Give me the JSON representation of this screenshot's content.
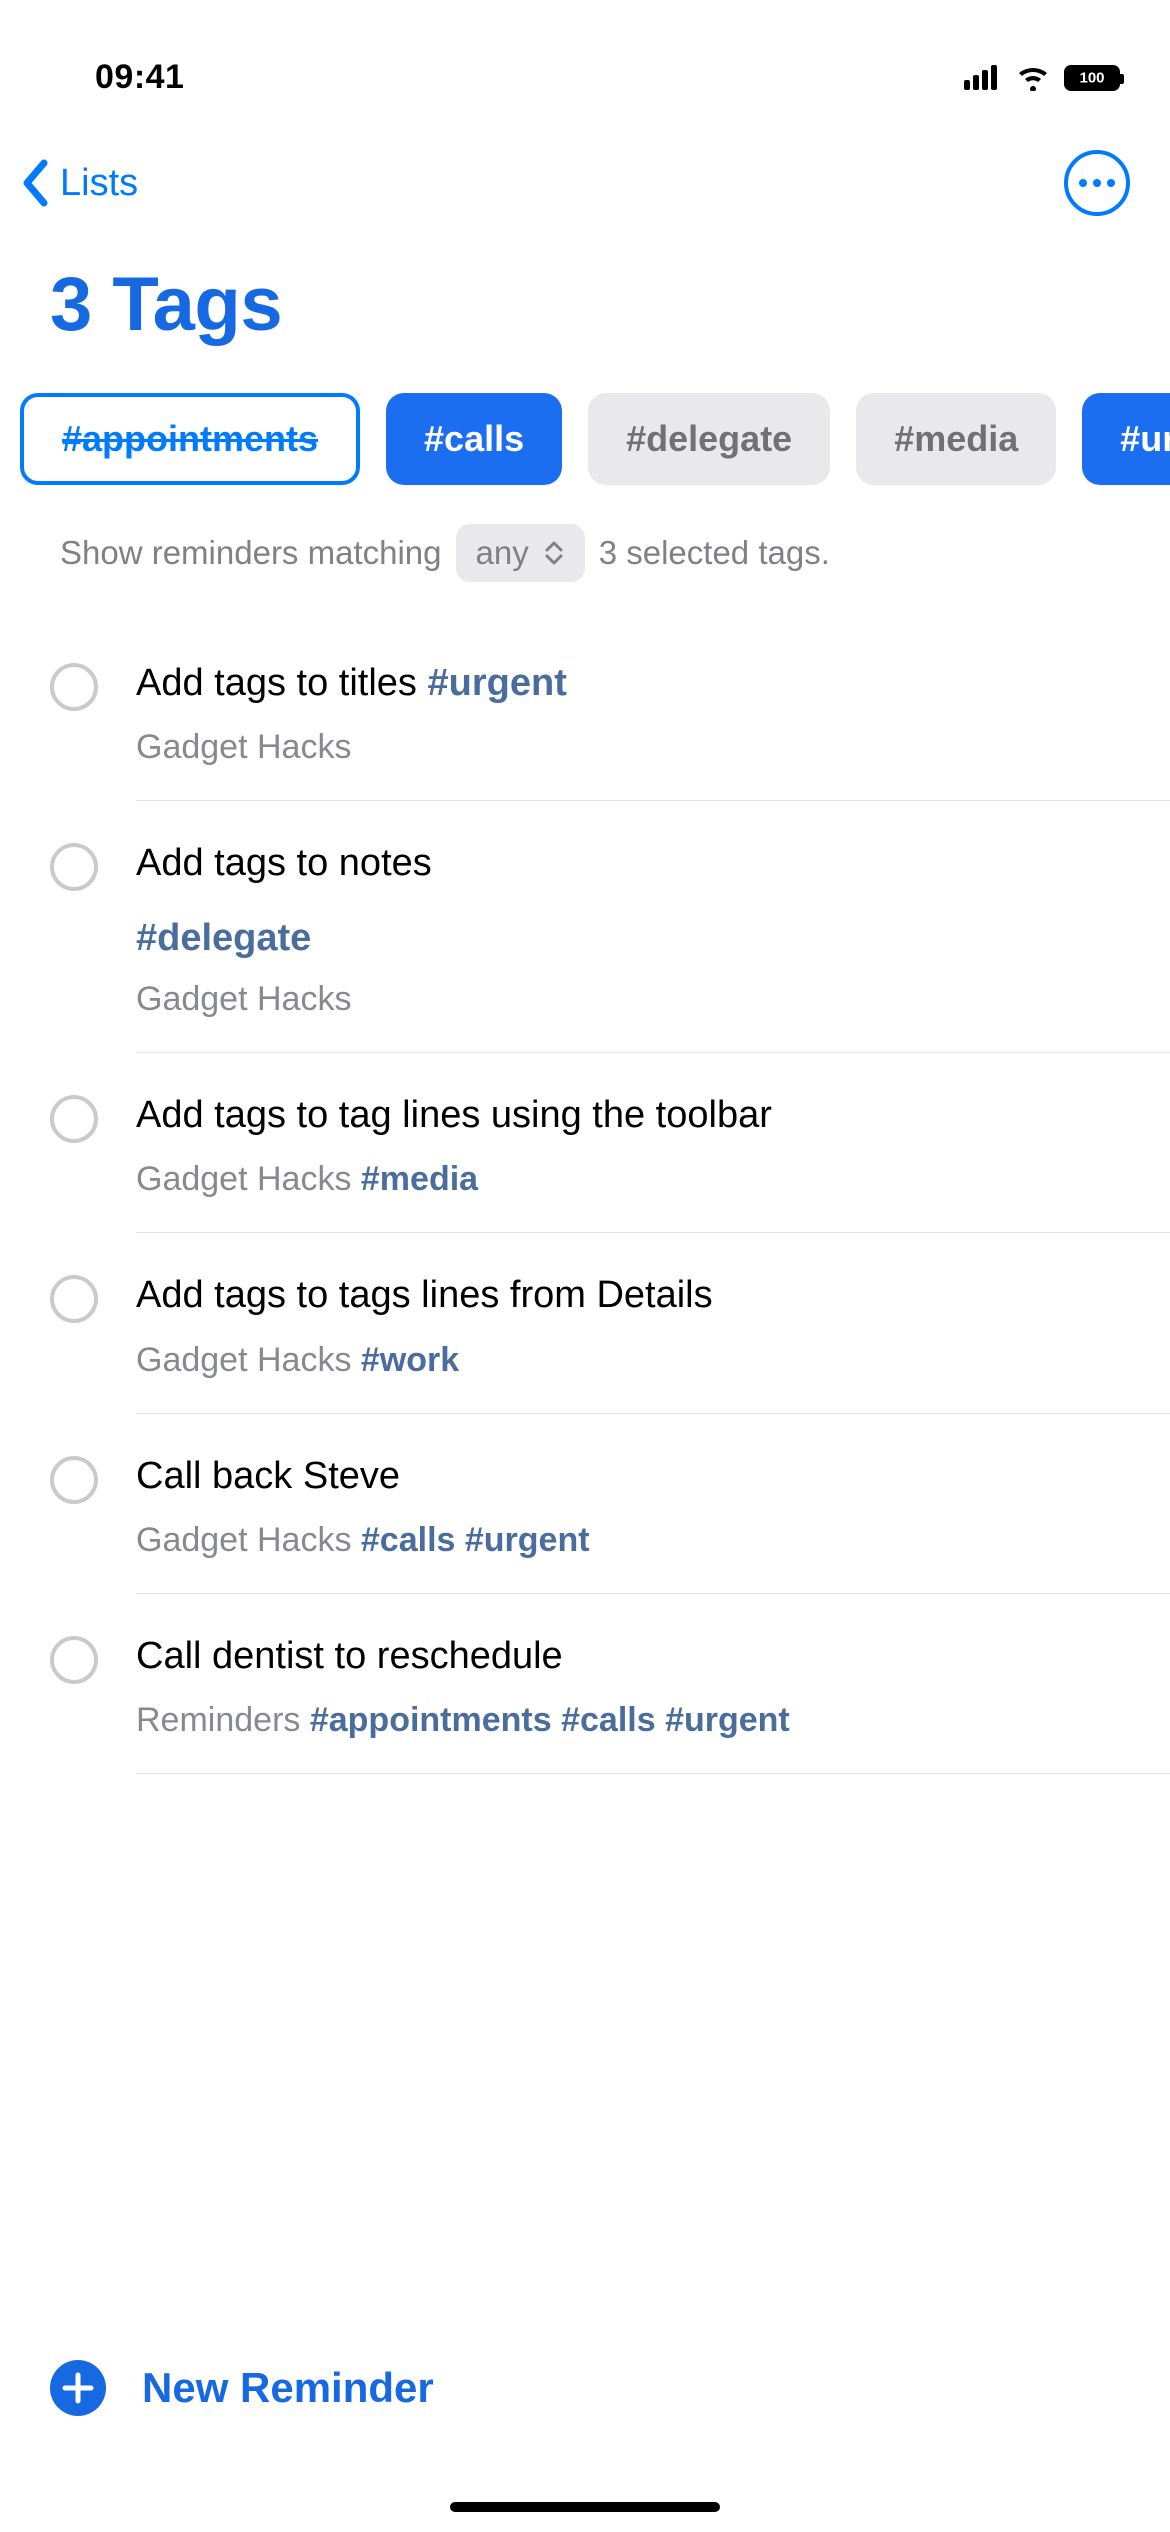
{
  "status": {
    "time": "09:41",
    "battery": "100"
  },
  "nav": {
    "back_label": "Lists"
  },
  "title": "3 Tags",
  "tags": [
    {
      "label": "#appointments",
      "state": "excluded"
    },
    {
      "label": "#calls",
      "state": "selected"
    },
    {
      "label": "#delegate",
      "state": "unselected"
    },
    {
      "label": "#media",
      "state": "unselected"
    },
    {
      "label": "#urgent",
      "state": "selected"
    }
  ],
  "filter": {
    "prefix": "Show reminders matching",
    "mode": "any",
    "suffix": "3 selected tags."
  },
  "reminders": [
    {
      "title": "Add tags to titles ",
      "title_tag": "#urgent",
      "subtag": "",
      "list": "Gadget Hacks",
      "meta_tags": ""
    },
    {
      "title": "Add tags to notes",
      "title_tag": "",
      "subtag": "#delegate",
      "list": "Gadget Hacks",
      "meta_tags": ""
    },
    {
      "title": "Add tags to tag lines using the toolbar",
      "title_tag": "",
      "subtag": "",
      "list": "Gadget Hacks ",
      "meta_tags": "#media"
    },
    {
      "title": "Add tags to tags lines from Details",
      "title_tag": "",
      "subtag": "",
      "list": "Gadget Hacks ",
      "meta_tags": "#work"
    },
    {
      "title": "Call back Steve",
      "title_tag": "",
      "subtag": "",
      "list": "Gadget Hacks ",
      "meta_tags": "#calls #urgent"
    },
    {
      "title": "Call dentist to reschedule",
      "title_tag": "",
      "subtag": "",
      "list": "Reminders ",
      "meta_tags": "#appointments #calls #urgent"
    }
  ],
  "new_reminder_label": "New Reminder"
}
